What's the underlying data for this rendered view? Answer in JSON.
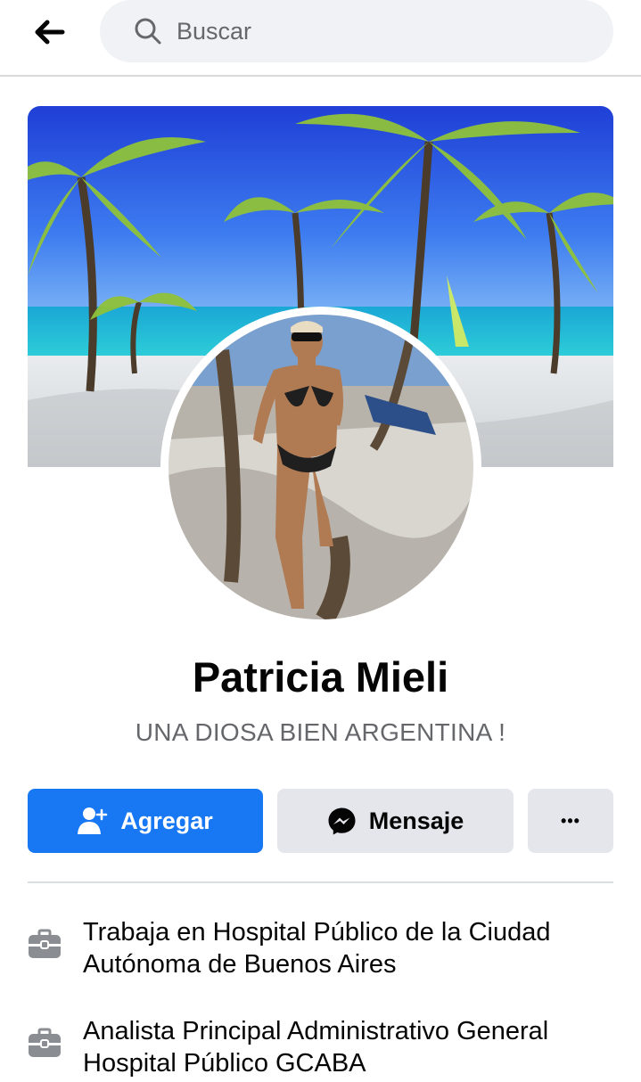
{
  "search": {
    "placeholder": "Buscar"
  },
  "profile": {
    "name": "Patricia Mieli",
    "bio": "UNA DIOSA BIEN ARGENTINA !"
  },
  "actions": {
    "add_label": "Agregar",
    "message_label": "Mensaje",
    "more_label": "•••"
  },
  "info": [
    {
      "icon": "briefcase-icon",
      "text": "Trabaja en Hospital Público de la Ciudad Autónoma de Buenos Aires"
    },
    {
      "icon": "briefcase-icon",
      "text": "Analista Principal Administrativo General Hospital Público GCABA"
    }
  ],
  "colors": {
    "primary": "#1877f2",
    "secondary_button": "#e4e6eb",
    "search_bg": "#f0f2f5",
    "muted_text": "#65676b"
  }
}
